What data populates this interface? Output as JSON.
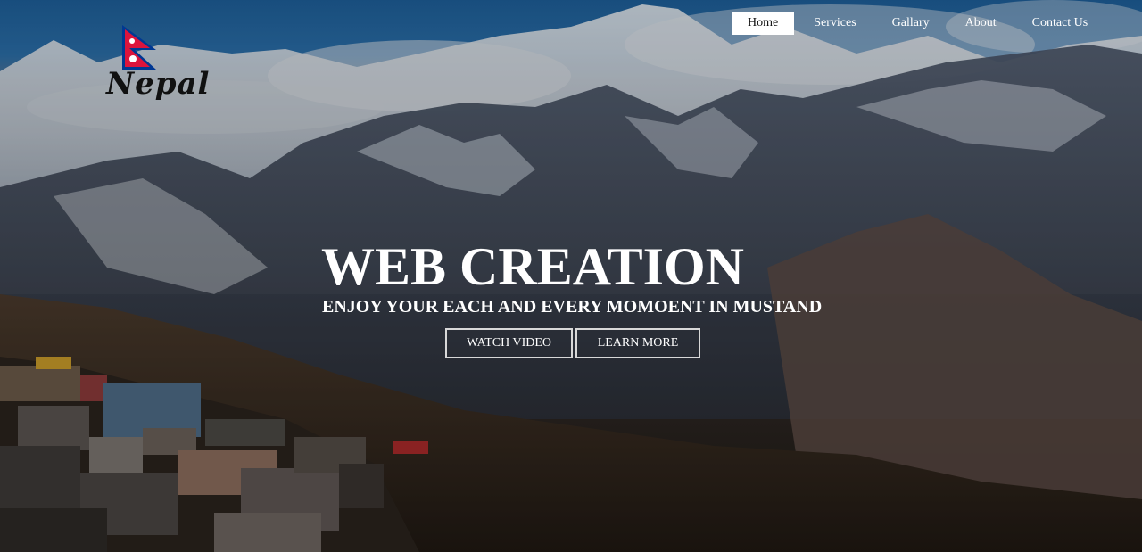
{
  "brand": {
    "logo_text": "Nepal",
    "logo_icon": "nepal-flag-icon"
  },
  "nav": {
    "items": [
      {
        "label": "Home",
        "active": true
      },
      {
        "label": "Services",
        "active": false
      },
      {
        "label": "Gallary",
        "active": false
      },
      {
        "label": "About",
        "active": false
      },
      {
        "label": "Contact Us",
        "active": false
      }
    ]
  },
  "hero": {
    "title": "WEB CREATION",
    "subtitle": "ENJOY YOUR EACH AND EVERY MOMOENT IN MUSTAND",
    "watch_label": "WATCH VIDEO",
    "learn_label": "LEARN MORE"
  },
  "colors": {
    "flag_crimson": "#dc143c",
    "flag_border": "#003893",
    "nav_active_bg": "#ffffff",
    "text": "#ffffff"
  }
}
